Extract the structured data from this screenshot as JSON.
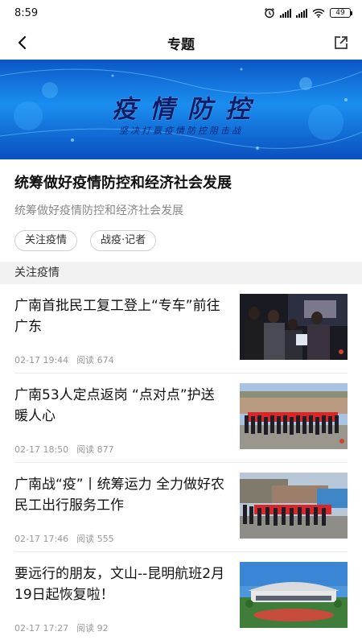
{
  "status_bar": {
    "time": "8:59",
    "battery": "49"
  },
  "nav": {
    "title": "专题"
  },
  "banner": {
    "title": "疫情防控",
    "subtitle": "坚决打赢疫情防控阻击战"
  },
  "topic": {
    "title": "统筹做好疫情防控和经济社会发展",
    "description": "统筹做好疫情防控和经济社会发展",
    "tags": [
      "关注疫情",
      "战疫·记者"
    ]
  },
  "section": {
    "title": "关注疫情"
  },
  "articles": [
    {
      "title": "广南首批民工复工登上“专车”前往广东",
      "date": "02-17 19:44",
      "reads": "阅读 674"
    },
    {
      "title": "广南53人定点返岗 “点对点”护送暖人心",
      "date": "02-17 18:50",
      "reads": "阅读 877"
    },
    {
      "title": "广南战“疫”丨统筹运力 全力做好农民工出行服务工作",
      "date": "02-17 17:46",
      "reads": "阅读 555"
    },
    {
      "title": "要远行的朋友，文山--昆明航班2月19日起恢复啦！",
      "date": "02-17 17:27",
      "reads": "阅读 92"
    }
  ]
}
